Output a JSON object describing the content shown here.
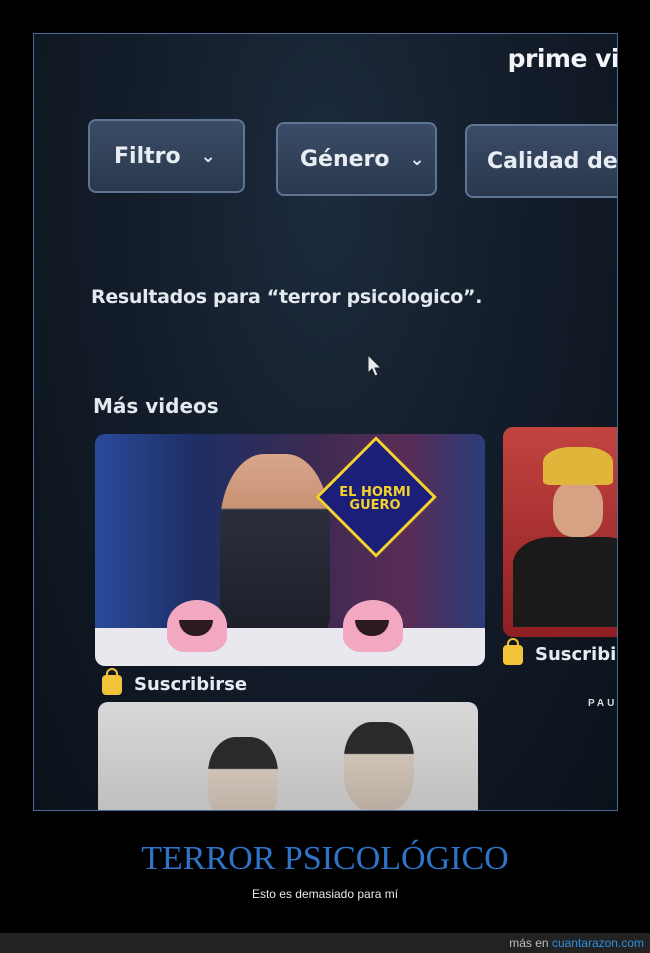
{
  "app": {
    "brand": "prime vi"
  },
  "filters": [
    {
      "label": "Filtro",
      "chevron": "⌄"
    },
    {
      "label": "Género",
      "chevron": "⌄"
    },
    {
      "label": "Calidad de v"
    }
  ],
  "search": {
    "results_text": "Resultados para “terror psicologico”."
  },
  "section": {
    "title": "Más videos"
  },
  "cards": [
    {
      "logo_text": "EL HORMI GUERO",
      "subscribe_label": "Suscribirse"
    },
    {
      "subscribe_label": "Suscribirs"
    },
    {}
  ],
  "partial_text": "PAU",
  "meme": {
    "title": "TERROR PSICOLÓGICO",
    "subtitle": "Esto es demasiado para mí",
    "footer_prefix": "más en",
    "footer_site": "cuantarazon.com"
  },
  "colors": {
    "accent_blue": "#2e74c8",
    "subscribe_icon": "#f3c43a"
  }
}
